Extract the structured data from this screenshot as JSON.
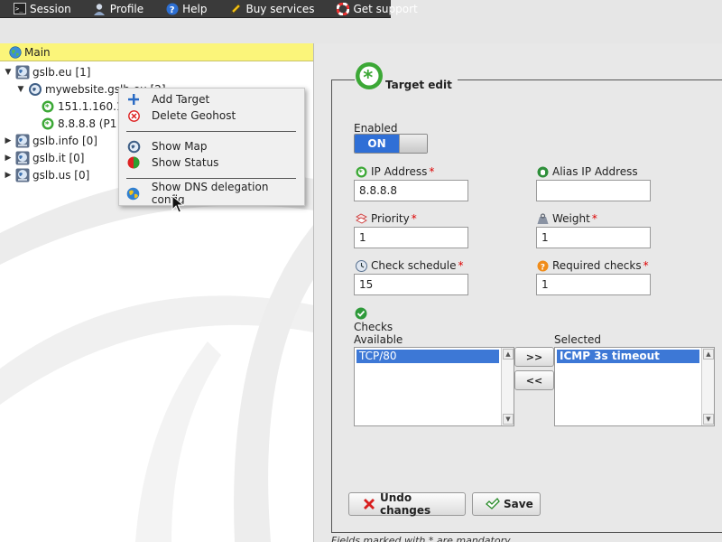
{
  "menu": {
    "items": [
      {
        "label": "Session",
        "icon": "terminal-icon"
      },
      {
        "label": "Profile",
        "icon": "user-icon"
      },
      {
        "label": "Help",
        "icon": "help-icon"
      },
      {
        "label": "Buy services",
        "icon": "pencil-icon"
      },
      {
        "label": "Get support",
        "icon": "lifebuoy-icon"
      }
    ]
  },
  "tree": {
    "header": "Main",
    "nodes": [
      {
        "label": "gslb.eu [1]",
        "expanded": true
      },
      {
        "label": "mywebsite.gslb.eu [2]",
        "expanded": true
      },
      {
        "label": "151.1.160.1"
      },
      {
        "label": "8.8.8.8 (P1 W"
      },
      {
        "label": "gslb.info [0]",
        "expanded": false
      },
      {
        "label": "gslb.it [0]",
        "expanded": false
      },
      {
        "label": "gslb.us [0]",
        "expanded": false
      }
    ]
  },
  "context_menu": {
    "add_target": "Add Target",
    "delete_geohost": "Delete Geohost",
    "show_map": "Show Map",
    "show_status": "Show Status",
    "show_dns": "Show DNS delegation config"
  },
  "form": {
    "title": "Target edit",
    "enabled_label": "Enabled",
    "enabled_state": "ON",
    "ip_label": "IP Address",
    "ip_value": "8.8.8.8",
    "alias_label": "Alias IP Address",
    "alias_value": "",
    "priority_label": "Priority",
    "priority_value": "1",
    "weight_label": "Weight",
    "weight_value": "1",
    "schedule_label": "Check schedule",
    "schedule_value": "15",
    "required_label": "Required checks",
    "required_value": "1",
    "checks_label": "Checks",
    "available_label": "Available",
    "selected_label": "Selected",
    "available_options": [
      "TCP/80"
    ],
    "selected_options": [
      "ICMP 3s timeout"
    ],
    "add_btn": ">>",
    "remove_btn": "<<",
    "undo_btn": "Undo changes",
    "save_btn": "Save",
    "required_marker": "*",
    "footnote": "Fields marked with * are mandatory"
  },
  "colors": {
    "menubar": "#3a3a3a",
    "header": "#fbf57a",
    "accent": "#2f6fd6",
    "required": "#dd0000"
  }
}
